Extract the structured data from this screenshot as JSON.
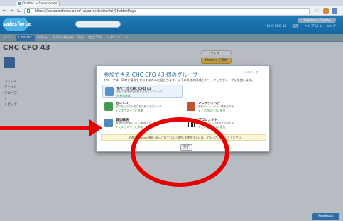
{
  "browser": {
    "tab_title": "Chatter ~ Salesforce",
    "tab_close": "×",
    "url": "https://ap.salesforce.com/_ui/core/chatter/ui/ChatterPage",
    "back": "←",
    "forward": "→",
    "reload": "C",
    "star": "☆"
  },
  "header": {
    "logo": "salesforce",
    "app_label": "Salesforce Chatter",
    "nav": [
      "CHC CFO 43",
      "設定",
      "ヘルプ&トレーニング"
    ]
  },
  "app_tabs": [
    "ホーム",
    "Chatter",
    "取引先",
    "取引先責任者",
    "商談",
    "売上予測",
    "レポート",
    "+"
  ],
  "active_tab": "Chatter",
  "page": {
    "title": "CHC CFO 43",
    "follow_label": "フォロー",
    "chatter_button": "Chatter を開始"
  },
  "sidebar": {
    "items": [
      "フィード",
      "ファイル",
      "グループ",
      "人",
      "トピック"
    ]
  },
  "dialog": {
    "title": "参加できる CHC CFO 43 個のグループ",
    "close_label": "« スキップ",
    "subtitle": "グループは、同僚と情報を共有するために役立ちます。以下の参加の候補をクリックしてグループに参加します。",
    "groups": [
      {
        "name": "すべての CHC CFO 43",
        "desc": "会社の全体的な情報を共有するグループ",
        "join": "+ 参加済み"
      },
      {
        "name": "セールス",
        "desc": "取引先とのやり取りを共有するグループ",
        "join": "+ このグループに参加"
      },
      {
        "name": "マーケティング",
        "desc": "最新のキャンペーン情報を共有",
        "join": "+ このグループに参加"
      },
      {
        "name": "製品戦略",
        "desc": "新製品の計画について議論する",
        "join": "+ このグループに参加"
      },
      {
        "name": "プロジェクト",
        "desc": "プロジェクトの進捗を共有する",
        "join": "+ このグループに参加"
      }
    ],
    "note": "必要な Chatter 機能 (表示されていない場合) を使用するには、グループに参加してください。",
    "done_label": "完了"
  },
  "feedback_label": "Feedback",
  "colors": {
    "header_blue": "#1565a0",
    "annotation_red": "#e60000",
    "join_green": "#2c8a2c"
  }
}
